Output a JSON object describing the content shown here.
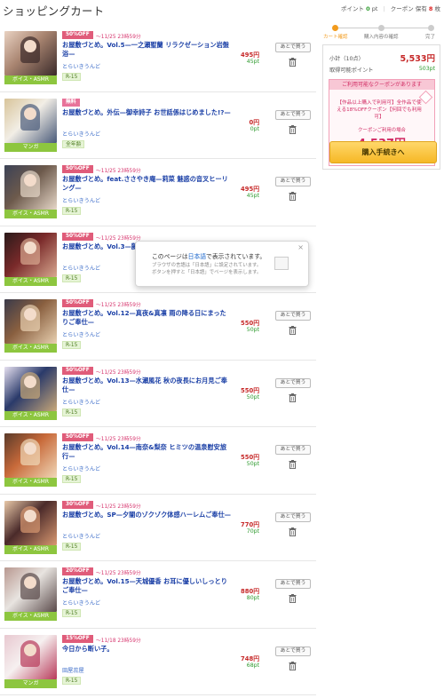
{
  "header": {
    "title": "ショッピングカート",
    "points_label": "ポイント",
    "points_value": "0",
    "points_unit": "pt",
    "coupon_label": "クーポン 保有",
    "coupon_value": "8",
    "coupon_unit": "枚"
  },
  "items": [
    {
      "badge": "50%OFF",
      "deadline": "〜11/25 23時59分",
      "title": "お屋敷づとめ。Vol.5—一之瀬聖蘭 リラクゼーション岩盤浴—",
      "circle": "とらいきうんど",
      "age": "R-15",
      "genre": "ボイス・ASMR",
      "price": "495円",
      "points": "45pt",
      "later": "あとで買う",
      "thumb_colors": [
        "#a88470",
        "#3a2a2a",
        "#e9d2c2"
      ]
    },
    {
      "badge": "無料",
      "deadline": "",
      "title": "お屋敷づとめ。外伝—御幸詩子 お世話係はじめました!?—",
      "circle": "とらいきうんど",
      "age": "全年齢",
      "genre": "マンガ",
      "price": "0円",
      "points": "0pt",
      "later": "あとで買う",
      "thumb_colors": [
        "#f2eee6",
        "#4a5b7a",
        "#d8c49a"
      ]
    },
    {
      "badge": "50%OFF",
      "deadline": "〜11/25 23時59分",
      "title": "お屋敷づとめ。feat.ささやき庵—莉菜 魅惑の音叉ヒーリング—",
      "circle": "とらいきうんど",
      "age": "R-15",
      "genre": "ボイス・ASMR",
      "price": "495円",
      "points": "45pt",
      "later": "あとで買う",
      "thumb_colors": [
        "#6d5a4c",
        "#e6d7c8",
        "#3c4256"
      ]
    },
    {
      "badge": "50%OFF",
      "deadline": "〜11/25 23時59分",
      "title": "お屋敷づとめ。Vol.3—藤",
      "circle": "とらいきうんど",
      "age": "R-15",
      "genre": "ボイス・ASMR",
      "price": "",
      "points": "",
      "later": "",
      "thumb_colors": [
        "#7a2a2a",
        "#d8a890",
        "#2a1a1a"
      ]
    },
    {
      "badge": "50%OFF",
      "deadline": "〜11/25 23時59分",
      "title": "お屋敷づとめ。Vol.12—真夜&真凛 雨の降る日にまったりご奉仕—",
      "circle": "とらいきうんど",
      "age": "R-15",
      "genre": "ボイス・ASMR",
      "price": "550円",
      "points": "50pt",
      "later": "あとで買う",
      "thumb_colors": [
        "#8a6040",
        "#e8d0b0",
        "#3a3a4a"
      ]
    },
    {
      "badge": "50%OFF",
      "deadline": "〜11/25 23時59分",
      "title": "お屋敷づとめ。Vol.13—水瀬風花 秋の夜長にお月見ご奉仕—",
      "circle": "とらいきうんど",
      "age": "R-15",
      "genre": "ボイス・ASMR",
      "price": "550円",
      "points": "50pt",
      "later": "あとで買う",
      "thumb_colors": [
        "#2a3a6a",
        "#c8a878",
        "#e6e0f0"
      ]
    },
    {
      "badge": "50%OFF",
      "deadline": "〜11/25 23時59分",
      "title": "お屋敷づとめ。Vol.14—南奈&梨奈 ヒミツの温泉慰安旅行—",
      "circle": "とらいきうんど",
      "age": "R-15",
      "genre": "ボイス・ASMR",
      "price": "550円",
      "points": "50pt",
      "later": "あとで買う",
      "thumb_colors": [
        "#c86a3a",
        "#f0d8b8",
        "#5a3a2a"
      ]
    },
    {
      "badge": "30%OFF",
      "deadline": "〜11/25 23時59分",
      "title": "お屋敷づとめ。SP—夕闇のゾクゾク体感ハーレムご奉仕—",
      "circle": "とらいきうんど",
      "age": "R-15",
      "genre": "ボイス・ASMR",
      "price": "770円",
      "points": "70pt",
      "later": "あとで買う",
      "thumb_colors": [
        "#4a2a2a",
        "#d89870",
        "#e8c8a8"
      ]
    },
    {
      "badge": "20%OFF",
      "deadline": "〜11/25 23時59分",
      "title": "お屋敷づとめ。Vol.15—天城優香 お耳に優しいしっとりご奉仕—",
      "circle": "とらいきうんど",
      "age": "R-15",
      "genre": "ボイス・ASMR",
      "price": "880円",
      "points": "80pt",
      "later": "あとで買う",
      "thumb_colors": [
        "#e8e4e0",
        "#5a4a4a",
        "#b89890"
      ]
    },
    {
      "badge": "15%OFF",
      "deadline": "〜11/18 23時59分",
      "title": "今日から断い子。",
      "circle": "田屋蕊屋",
      "age": "R-15",
      "genre": "マンガ",
      "price": "748円",
      "points": "68pt",
      "later": "あとで買う",
      "thumb_colors": [
        "#f6f0f0",
        "#b83a5a",
        "#e8c8d0"
      ]
    }
  ],
  "steps": [
    {
      "label": "カート確認",
      "active": true
    },
    {
      "label": "購入内容の確認",
      "active": false
    },
    {
      "label": "完了",
      "active": false
    }
  ],
  "summary": {
    "subtotal_label": "小計（10点）",
    "subtotal_value": "5,533円",
    "points_label": "取得可能ポイント",
    "points_value": "503pt",
    "coupon_head": "ご利用可能なクーポンがあります",
    "coupon_desc": "【作品以上購入で利用可】全作品で使える18%OFFクーポン【何回でも利用可】",
    "coupon_sub": "クーポンご利用の場合",
    "coupon_price": "4,537円",
    "checkout_label": "購入手続きへ"
  },
  "popup": {
    "line1_pre": "このページは",
    "line1_hl": "日本語",
    "line1_post": "で表示されています。",
    "line2a": "ブラウザの言語は「日本語」に設定されています。",
    "line2b": "ボタンを押すと「日本語」でページを表示します。",
    "close": "×"
  },
  "colors": {
    "accent": "#f29b1d",
    "price": "#c62828",
    "points": "#2e9a2e",
    "link": "#1a3fa6",
    "genre": "#8dc63f"
  }
}
